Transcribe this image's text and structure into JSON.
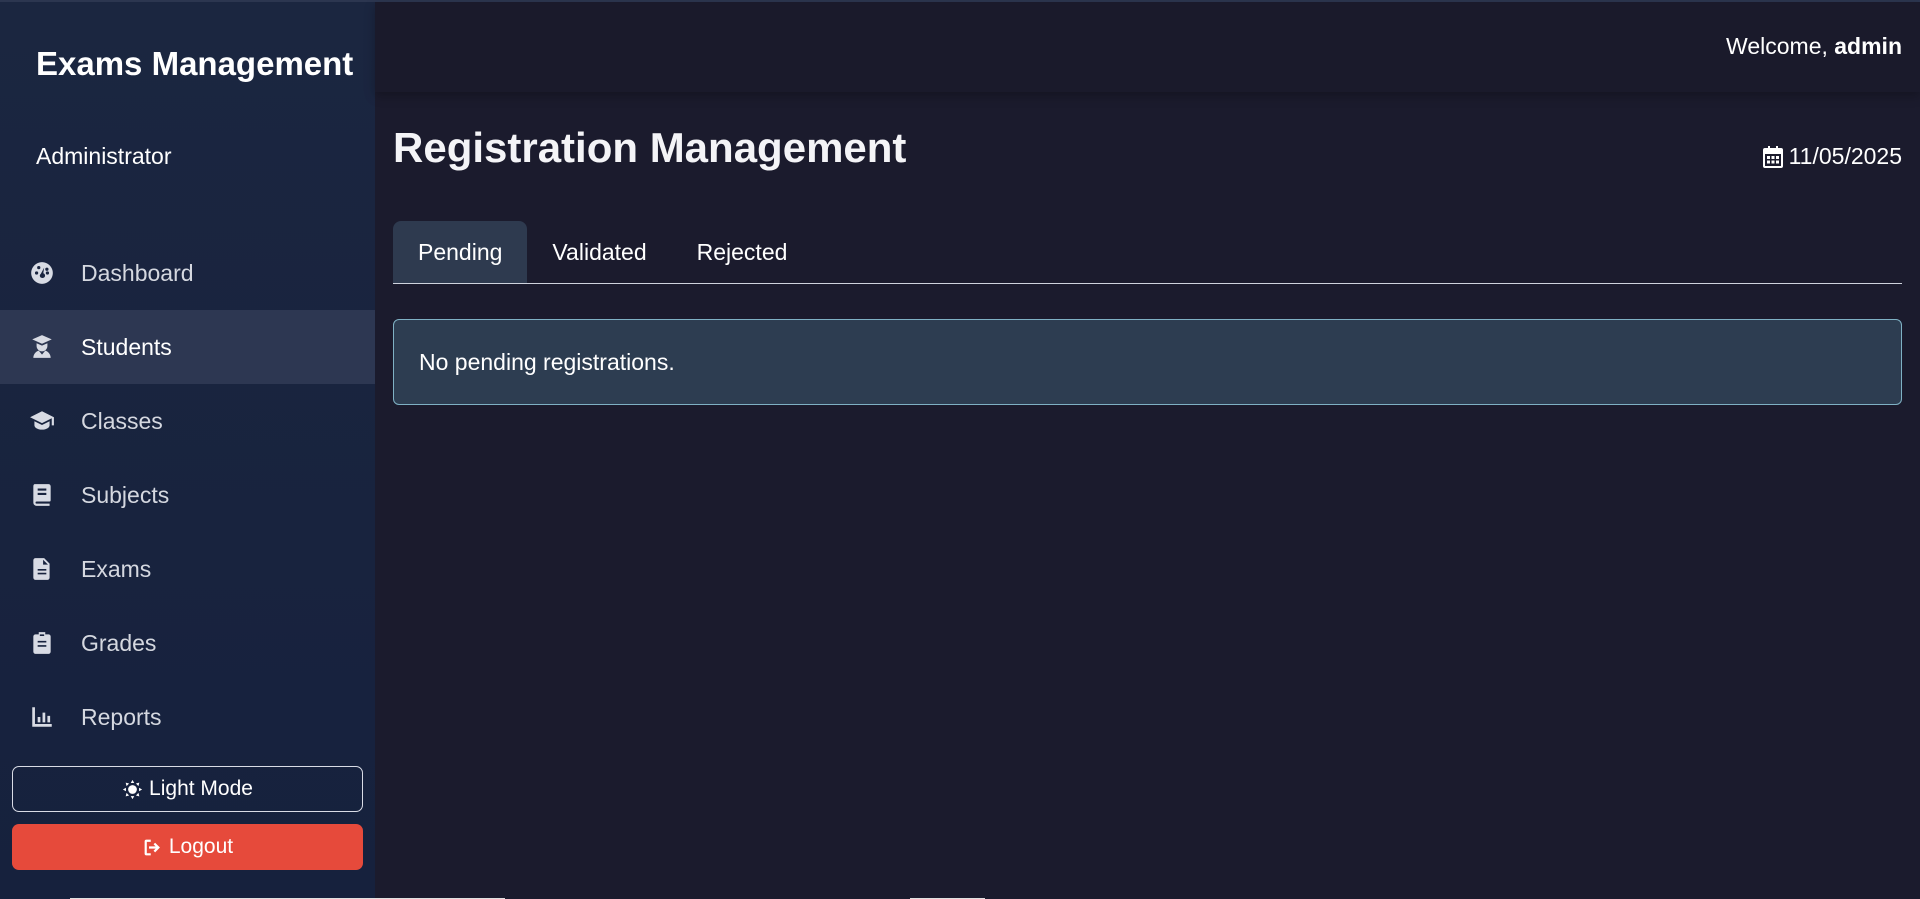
{
  "sidebar": {
    "brand_title": "Exams Management",
    "role": "Administrator",
    "items": [
      {
        "label": "Dashboard",
        "icon": "dashboard-gauge-icon",
        "active": false
      },
      {
        "label": "Students",
        "icon": "graduate-user-icon",
        "active": true
      },
      {
        "label": "Classes",
        "icon": "graduation-cap-icon",
        "active": false
      },
      {
        "label": "Subjects",
        "icon": "book-icon",
        "active": false
      },
      {
        "label": "Exams",
        "icon": "document-icon",
        "active": false
      },
      {
        "label": "Grades",
        "icon": "clipboard-icon",
        "active": false
      },
      {
        "label": "Reports",
        "icon": "bar-chart-icon",
        "active": false
      }
    ],
    "light_mode_label": "Light Mode",
    "logout_label": "Logout"
  },
  "header": {
    "welcome_prefix": "Welcome,",
    "username": "admin"
  },
  "main": {
    "title": "Registration Management",
    "date": "11/05/2025",
    "tabs": [
      {
        "label": "Pending",
        "active": true
      },
      {
        "label": "Validated",
        "active": false
      },
      {
        "label": "Rejected",
        "active": false
      }
    ],
    "alert_text": "No pending registrations."
  },
  "colors": {
    "background": "#1b1b2d",
    "sidebar": "#16213d",
    "active_item": "#2d3752",
    "logout": "#e64a3b",
    "alert_bg": "#2d3d51",
    "alert_border": "#7fb1c4"
  }
}
